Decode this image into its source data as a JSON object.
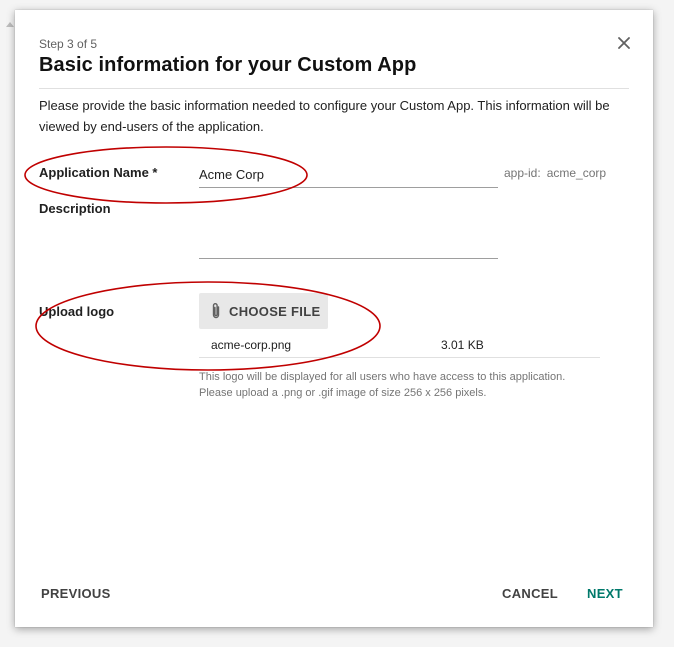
{
  "dialog": {
    "step": "Step 3 of 5",
    "title": "Basic information for your Custom App",
    "intro": "Please provide the basic information needed to configure your Custom App. This information will be viewed by end-users of the application."
  },
  "form": {
    "app_name_label": "Application Name *",
    "app_name_value": "Acme Corp",
    "app_id_label": "app-id:",
    "app_id_value": "acme_corp",
    "description_label": "Description",
    "description_value": "",
    "upload_label": "Upload logo",
    "choose_file_label": "CHOOSE FILE",
    "file_name": "acme-corp.png",
    "file_size": "3.01 KB",
    "hint_line1": "This logo will be displayed for all users who have access to this application.",
    "hint_line2": "Please upload a .png or .gif image of size 256 x 256 pixels."
  },
  "footer": {
    "previous_label": "PREVIOUS",
    "cancel_label": "CANCEL",
    "next_label": "NEXT"
  },
  "colors": {
    "accent": "#00796b",
    "annotation": "#c00000"
  },
  "icons": {
    "close": "close-icon",
    "attach": "paperclip-icon"
  }
}
